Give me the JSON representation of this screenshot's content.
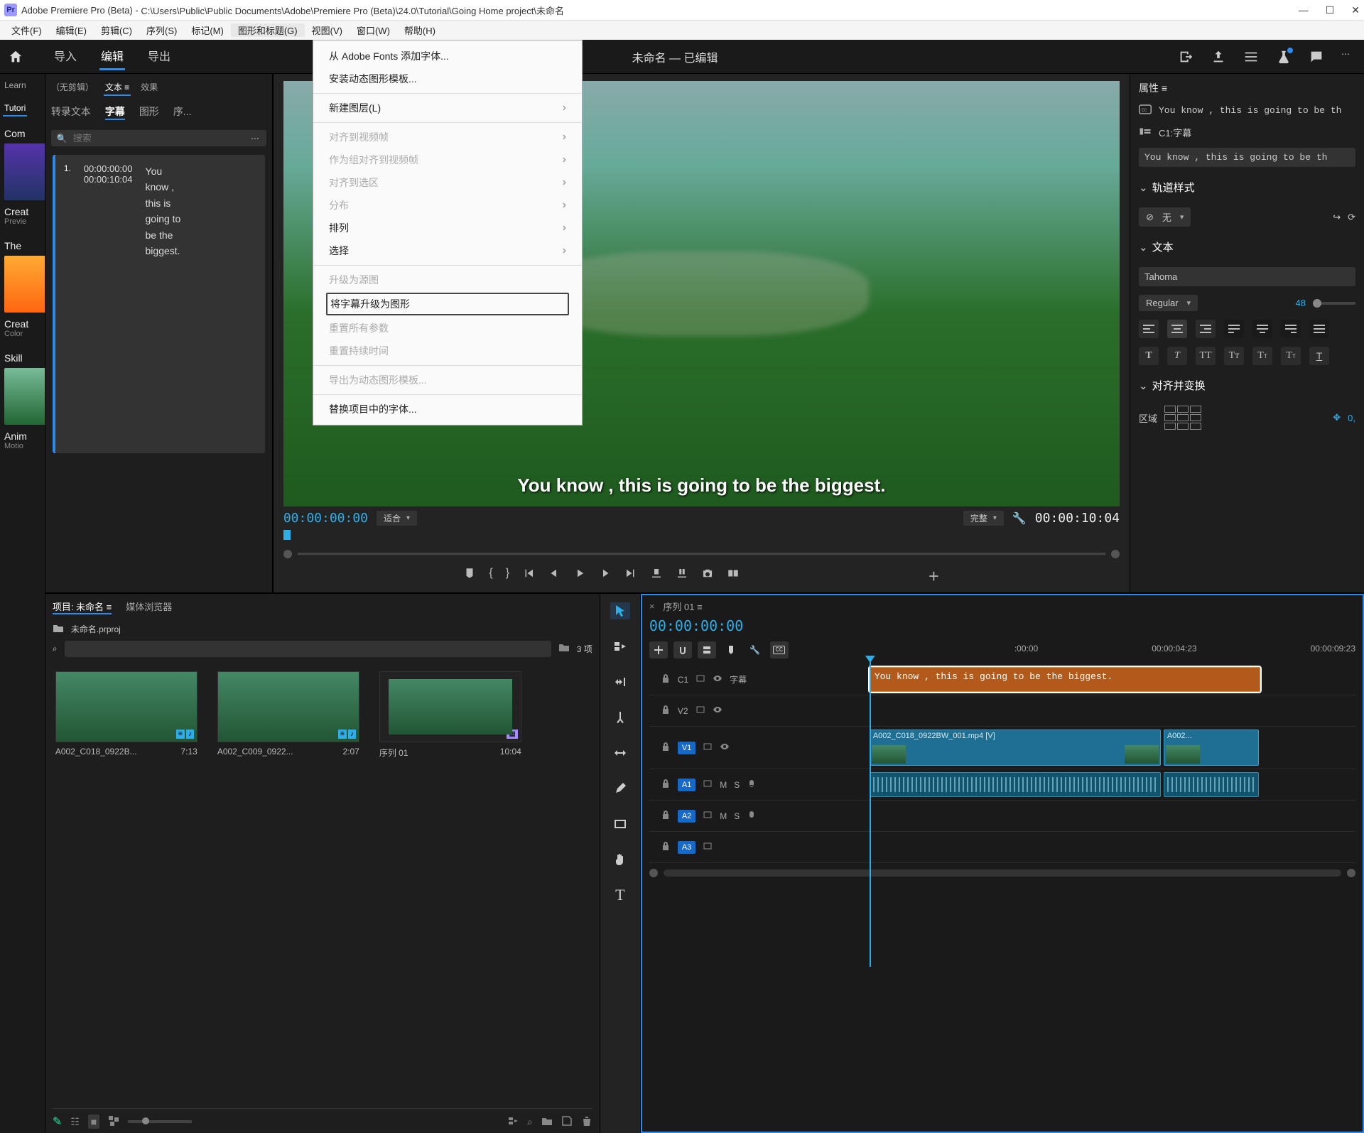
{
  "titlebar": {
    "app": "Adobe Premiere Pro (Beta)",
    "path": "C:\\Users\\Public\\Public Documents\\Adobe\\Premiere Pro (Beta)\\24.0\\Tutorial\\Going Home project\\未命名"
  },
  "menubar": {
    "file": "文件(F)",
    "edit": "编辑(E)",
    "clip": "剪辑(C)",
    "sequence": "序列(S)",
    "marker": "标记(M)",
    "graphics": "图形和标题(G)",
    "view": "视图(V)",
    "window": "窗口(W)",
    "help": "帮助(H)"
  },
  "workspace": {
    "import": "导入",
    "edit": "编辑",
    "export": "导出",
    "doc_title": "未命名 — 已编辑"
  },
  "dropdown": {
    "add_fonts": "从 Adobe Fonts 添加字体...",
    "install_mogrt": "安装动态图形模板...",
    "new_layer": "新建图层(L)",
    "align_video": "对齐到视频帧",
    "align_group": "作为组对齐到视频帧",
    "align_selection": "对齐到选区",
    "distribute": "分布",
    "arrange": "排列",
    "select": "选择",
    "upgrade_source": "升级为源图",
    "upgrade_caption": "将字幕升级为图形",
    "reset_params": "重置所有参数",
    "reset_duration": "重置持续时间",
    "export_mogrt": "导出为动态图形模板...",
    "replace_font": "替换项目中的字体..."
  },
  "learn": {
    "tab_learn": "Learn",
    "tab_tutori": "Tutori",
    "com": "Com",
    "creat1": "Creat",
    "previe": "Previe",
    "the": "The",
    "creat2": "Creat",
    "color": "Color",
    "skill": "Skill",
    "anim": "Anim",
    "motio": "Motio"
  },
  "captions": {
    "tab_noedit": "（无剪辑）",
    "tab_text": "文本 ≡",
    "tab_effects": "效果",
    "sub_transcript": "转录文本",
    "sub_captions": "字幕",
    "sub_graphics": "图形",
    "sub_seq": "序...",
    "search_ph": "搜索",
    "entry_num": "1.",
    "entry_in": "00:00:00:00",
    "entry_out": "00:00:10:04",
    "entry_text": "You know , this is going to be the biggest."
  },
  "program": {
    "caption_overlay": "You know , this is going to be the biggest.",
    "tc_in": "00:00:00:00",
    "fit": "适合",
    "full": "完整",
    "tc_out": "00:00:10:04"
  },
  "project": {
    "tab_project": "项目: 未命名 ≡",
    "tab_media": "媒体浏览器",
    "filename": "未命名.prproj",
    "item_count": "3 项",
    "bin1_name": "A002_C018_0922B...",
    "bin1_dur": "7:13",
    "bin2_name": "A002_C009_0922...",
    "bin2_dur": "2:07",
    "bin3_name": "序列 01",
    "bin3_dur": "10:04"
  },
  "timeline": {
    "seq_name": "序列 01 ≡",
    "tc": "00:00:00:00",
    "ruler_0": ":00:00",
    "ruler_1": "00:00:04:23",
    "ruler_2": "00:00:09:23",
    "track_c1": "C1",
    "track_c1_name": "字幕",
    "track_v2": "V2",
    "track_v1": "V1",
    "track_a1": "A1",
    "track_a2": "A2",
    "track_a3": "A3",
    "caption_clip": "You know , this is going to be the biggest.",
    "video_clip1": "A002_C018_0922BW_001.mp4 [V]",
    "video_clip2": "A002...",
    "audio_m": "M",
    "audio_s": "S"
  },
  "properties": {
    "title": "属性 ≡",
    "cc_text": "You know , this is going to be th",
    "track_label": "C1:字幕",
    "editable_text": "You know , this is going to be th",
    "sec_trackstyle": "轨道样式",
    "style_none": "无",
    "sec_text": "文本",
    "font_family": "Tahoma",
    "font_style": "Regular",
    "font_size": "48",
    "sec_align": "对齐并变换",
    "align_zone": "区域",
    "align_val": "0,"
  }
}
